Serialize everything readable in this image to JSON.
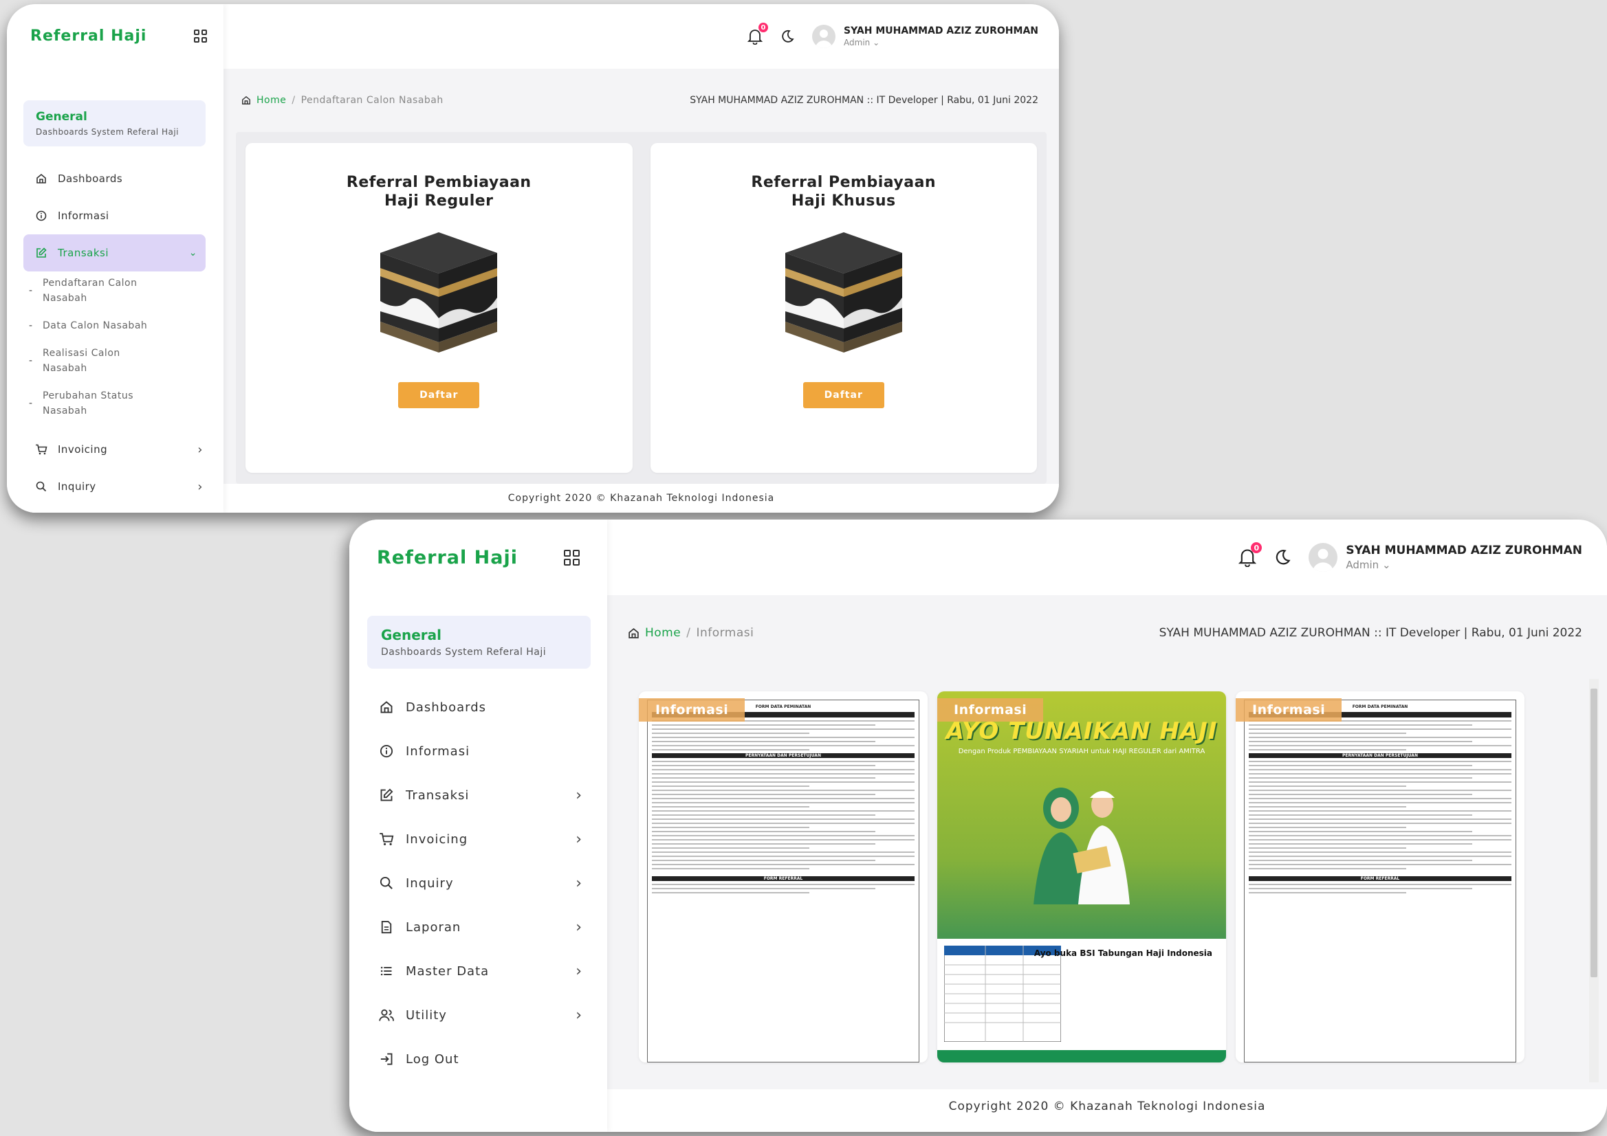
{
  "app": {
    "brand": "Referral Haji"
  },
  "user": {
    "name": "SYAH MUHAMMAD AZIZ ZUROHMAN",
    "role": "Admin",
    "notifications": "0"
  },
  "general": {
    "title": "General",
    "subtitle": "Dashboards System Referal Haji"
  },
  "footer": {
    "copyright": "Copyright 2020 © Khazanah Teknologi Indonesia"
  },
  "screen1": {
    "nav": {
      "dashboards": "Dashboards",
      "informasi": "Informasi",
      "transaksi": "Transaksi",
      "sub": [
        "Pendaftaran Calon Nasabah",
        "Data Calon Nasabah",
        "Realisasi Calon Nasabah",
        "Perubahan Status Nasabah"
      ],
      "invoicing": "Invoicing",
      "inquiry": "Inquiry"
    },
    "breadcrumb": {
      "home": "Home",
      "current": "Pendaftaran Calon Nasabah"
    },
    "pageinfo": "SYAH MUHAMMAD AZIZ ZUROHMAN :: IT Developer | Rabu, 01 Juni 2022",
    "cards": [
      {
        "title": "Referral Pembiayaan Haji Reguler",
        "button": "Daftar"
      },
      {
        "title": "Referral Pembiayaan Haji Khusus",
        "button": "Daftar"
      }
    ]
  },
  "screen2": {
    "nav": {
      "dashboards": "Dashboards",
      "informasi": "Informasi",
      "transaksi": "Transaksi",
      "invoicing": "Invoicing",
      "inquiry": "Inquiry",
      "laporan": "Laporan",
      "masterdata": "Master Data",
      "utility": "Utility",
      "logout": "Log Out"
    },
    "breadcrumb": {
      "home": "Home",
      "current": "Informasi"
    },
    "pageinfo": "SYAH MUHAMMAD AZIZ ZUROHMAN :: IT Developer | Rabu, 01 Juni 2022",
    "info_cards": [
      {
        "tag": "Informasi",
        "doc_title": "FORM DATA PEMINATAN",
        "doc_section": "PERNYATAAN DAN PERSETUJUAN",
        "doc_footer": "FORM REFERRAL"
      },
      {
        "tag": "Informasi",
        "headline": "AYO TUNAIKAN HAJI",
        "subline": "Dengan Produk PEMBIAYAAN SYARIAH untuk HAJI REGULER dari AMITRA",
        "bsi": "Ayo buka BSI Tabungan Haji Indonesia"
      },
      {
        "tag": "Informasi",
        "doc_title": "FORM DATA PEMINATAN",
        "doc_section": "PERNYATAAN DAN PERSETUJUAN",
        "doc_footer": "FORM REFERRAL"
      }
    ]
  },
  "colors": {
    "brand_green": "#1aa34a",
    "active_bg": "#ddd5f7",
    "button_orange": "#f0a63c",
    "badge_pink": "#ff2d6f"
  }
}
